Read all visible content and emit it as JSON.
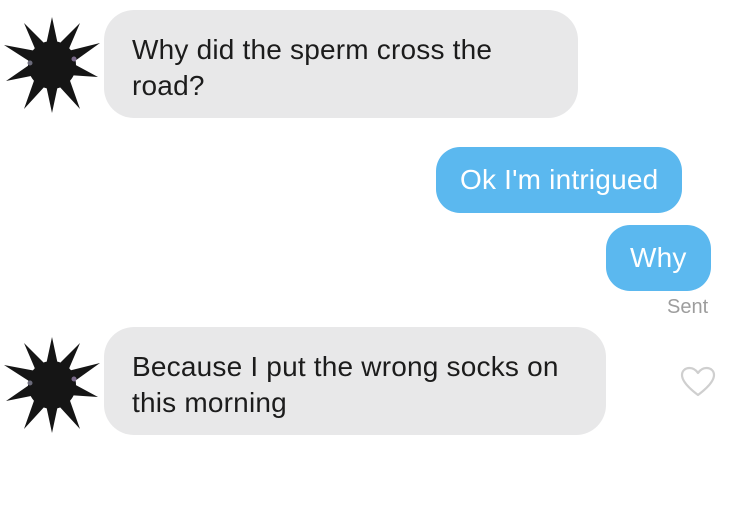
{
  "conversation": {
    "messages": [
      {
        "sender": "other",
        "text": "Why did the sperm cross the road?"
      },
      {
        "sender": "me",
        "text": "Ok I'm intrigued"
      },
      {
        "sender": "me",
        "text": "Why"
      },
      {
        "sender": "other",
        "text": "Because I put the wrong socks on this morning"
      }
    ],
    "status": "Sent"
  },
  "icons": {
    "avatar": "spiky-black-avatar-icon",
    "like": "heart-outline-icon"
  },
  "colors": {
    "incoming_bubble": "#e8e8e9",
    "outgoing_bubble": "#5bb8ef",
    "status_text": "#9d9d9d"
  }
}
